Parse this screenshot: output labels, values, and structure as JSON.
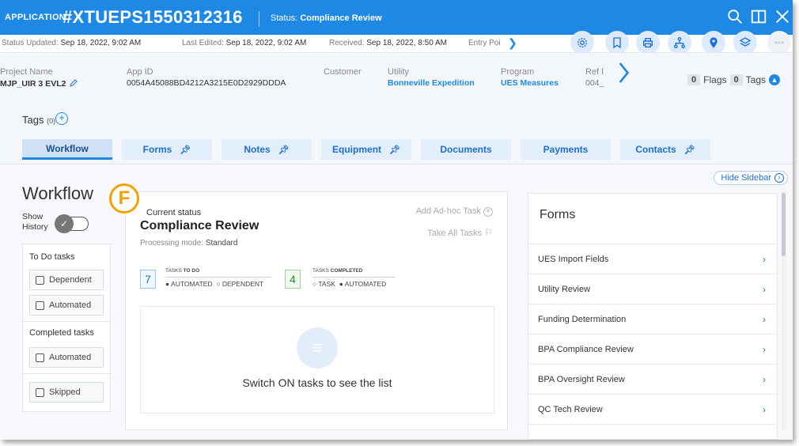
{
  "header": {
    "app_label": "APPLICATION",
    "app_id": "#XTUEPS1550312316",
    "status_label": "Status:",
    "status_value": "Compliance Review"
  },
  "status_line": {
    "updated_label": "Status Updated:",
    "updated_value": "Sep 18, 2022, 9:02 AM",
    "edited_label": "Last Edited:",
    "edited_value": "Sep 18, 2022, 9:02 AM",
    "received_label": "Received:",
    "received_value": "Sep 18, 2022, 8:50 AM",
    "entry_label": "Entry Poi"
  },
  "info": {
    "project_name_label": "Project Name",
    "project_name_value": "MJP_UIR 3 EVL2",
    "app_id_label": "App ID",
    "app_id_value": "0054A45088BD4212A3215E0D2929DDDA",
    "customer_label": "Customer",
    "utility_label": "Utility",
    "utility_value": "Bonneville Expedition",
    "program_label": "Program",
    "program_value": "UES Measures",
    "ref_label": "Ref I",
    "ref_value": "004_",
    "flags_count": "0",
    "flags_label": "Flags",
    "tags_count": "0",
    "tags_label": "Tags"
  },
  "tags": {
    "label": "Tags",
    "count": "(0)"
  },
  "tabs": [
    {
      "label": "Workflow"
    },
    {
      "label": "Forms"
    },
    {
      "label": "Notes"
    },
    {
      "label": "Equipment"
    },
    {
      "label": "Documents"
    },
    {
      "label": "Payments"
    },
    {
      "label": "Contacts"
    }
  ],
  "sidebar_toggle": "Hide Sidebar",
  "workflow": {
    "title": "Workflow",
    "show_history": "Show History",
    "todo_heading": "To Do tasks",
    "dependent": "Dependent",
    "automated": "Automated",
    "completed_heading": "Completed tasks",
    "completed_automated": "Automated",
    "skipped": "Skipped"
  },
  "marker": "F",
  "center": {
    "current_status_label": "Current status",
    "current_status_value": "Compliance Review",
    "mode_label": "Processing mode:",
    "mode_value": "Standard",
    "add_adhoc": "Add Ad-hoc Task",
    "take_all": "Take All Tasks",
    "todo_count": "7",
    "todo_title_prefix": "TASKS",
    "todo_title_bold": "TO DO",
    "todo_legend_a": "AUTOMATED",
    "todo_legend_b": "DEPENDENT",
    "done_count": "4",
    "done_title_prefix": "TASKS",
    "done_title_bold": "COMPLETED",
    "done_legend_a": "TASK",
    "done_legend_b": "AUTOMATED",
    "empty_message": "Switch ON tasks to see the list"
  },
  "forms": {
    "title": "Forms",
    "items": [
      "UES Import Fields",
      "Utility Review",
      "Funding Determination",
      "BPA Compliance Review",
      "BPA Oversight Review",
      "QC Tech Review"
    ]
  },
  "colors": {
    "primary": "#1e88e5",
    "marker": "#f5a000"
  }
}
